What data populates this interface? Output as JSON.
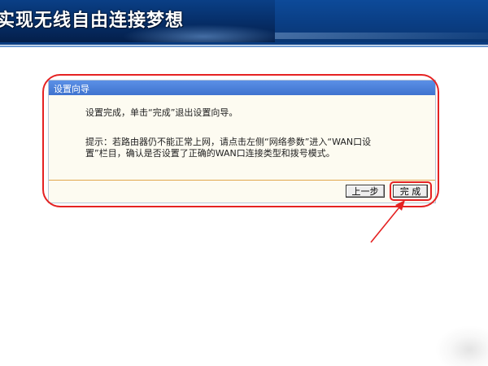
{
  "banner": {
    "title": "实现无线自由连接梦想"
  },
  "dialog": {
    "title": "设置向导",
    "message_complete": "设置完成，单击“完成”退出设置向导。",
    "tip_line1": "提示：若路由器仍不能正常上网，请点击左侧“网络参数”进入“WAN口设",
    "tip_line2": "置”栏目，确认是否设置了正确的WAN口连接类型和拨号模式。",
    "buttons": {
      "prev_label": "上一步",
      "finish_label": "完 成"
    }
  },
  "colors": {
    "banner_blue": "#062d66",
    "dialog_header_blue": "#4a80dc",
    "dialog_background": "#fdfbf1",
    "annotation_red": "#e52222",
    "divider_orange": "#e2a74d"
  }
}
